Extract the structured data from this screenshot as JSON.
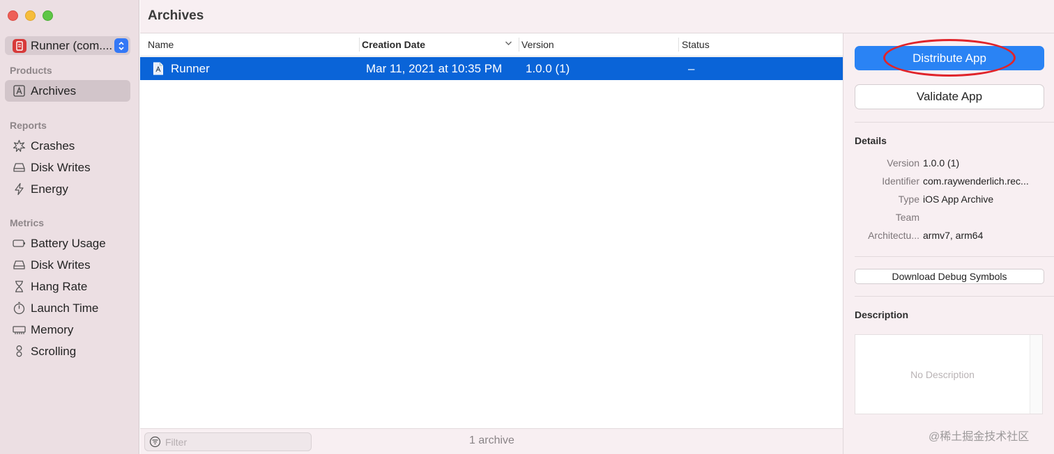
{
  "window": {
    "title": "Archives"
  },
  "app_selector": {
    "label": "Runner (com...."
  },
  "sidebar": {
    "products_label": "Products",
    "archives_label": "Archives",
    "reports_label": "Reports",
    "reports": [
      "Crashes",
      "Disk Writes",
      "Energy"
    ],
    "metrics_label": "Metrics",
    "metrics": [
      "Battery Usage",
      "Disk Writes",
      "Hang Rate",
      "Launch Time",
      "Memory",
      "Scrolling"
    ]
  },
  "table": {
    "columns": [
      "Name",
      "Creation Date",
      "Version",
      "Status"
    ],
    "sorted_column": "Creation Date",
    "rows": [
      {
        "name": "Runner",
        "creation_date": "Mar 11, 2021 at 10:35 PM",
        "version": "1.0.0 (1)",
        "status": "–"
      }
    ]
  },
  "footer": {
    "filter_placeholder": "Filter",
    "archive_count": "1 archive"
  },
  "inspector": {
    "distribute_label": "Distribute App",
    "validate_label": "Validate App",
    "details_heading": "Details",
    "details": [
      {
        "key": "Version",
        "value": "1.0.0 (1)"
      },
      {
        "key": "Identifier",
        "value": "com.raywenderlich.rec..."
      },
      {
        "key": "Type",
        "value": "iOS App Archive"
      },
      {
        "key": "Team",
        "value": ""
      },
      {
        "key": "Architectu...",
        "value": "armv7, arm64"
      }
    ],
    "debug_symbols_label": "Download Debug Symbols",
    "description_heading": "Description",
    "description_placeholder": "No Description"
  },
  "watermark": "@稀土掘金技术社区",
  "colors": {
    "accent": "#0a64d8",
    "primary_button": "#2a83f4",
    "annotation_ring": "#e0242a",
    "sidebar_bg": "#ecdfe3"
  },
  "icons": {
    "archives": "archive-box-icon",
    "crashes": "starburst-icon",
    "disk_writes": "drive-icon",
    "energy": "bolt-icon",
    "battery": "battery-icon",
    "hang_rate": "hourglass-icon",
    "launch_time": "stopwatch-icon",
    "memory": "memory-chip-icon",
    "scrolling": "scroll-icon"
  }
}
